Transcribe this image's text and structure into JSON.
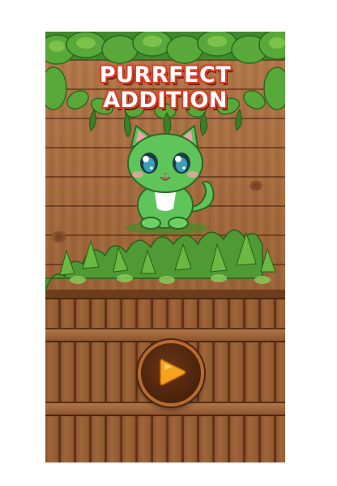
{
  "game": {
    "title": "PURRFECT ADDITION"
  },
  "icons": {
    "mascot": "green-kitten-icon",
    "play": "play-icon"
  },
  "colors": {
    "title_fill": "#ffffff",
    "title_outline": "#d6402a",
    "play_accent": "#f5a21e",
    "play_ring": "#b56a30",
    "cat_green": "#5fc45a",
    "foliage": "#4f9a34"
  }
}
